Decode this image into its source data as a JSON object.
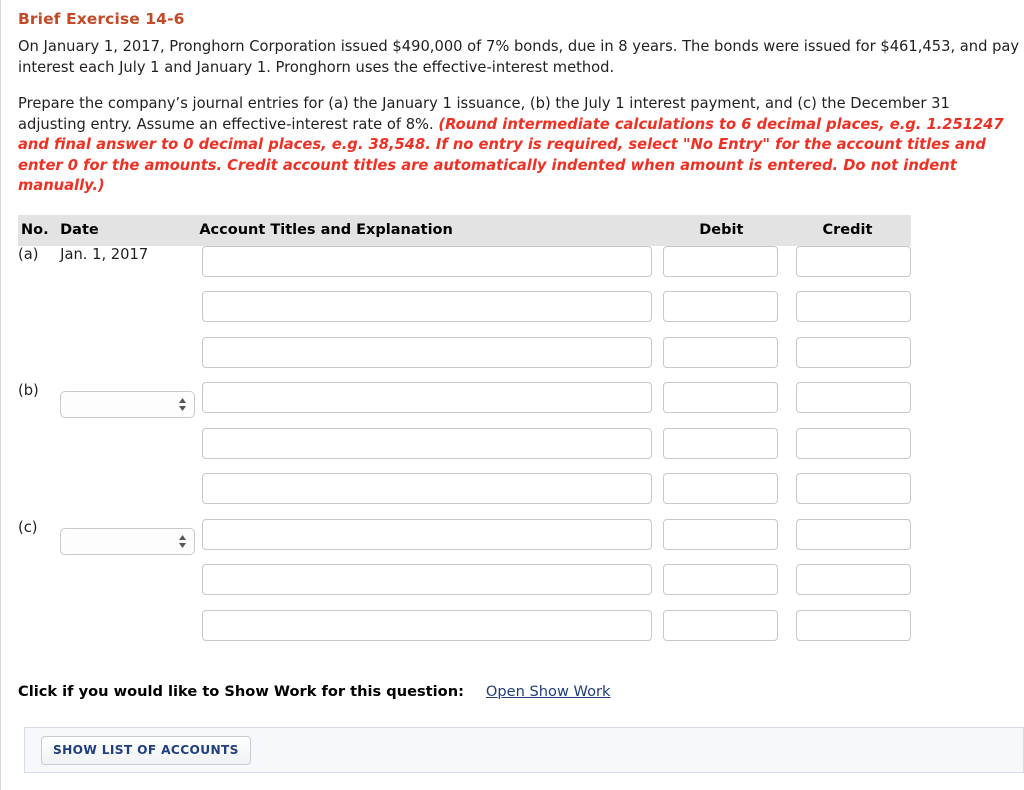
{
  "exercise": {
    "title": "Brief Exercise 14-6",
    "paragraph1": "On January 1, 2017, Pronghorn Corporation issued $490,000 of 7% bonds, due in 8 years. The bonds were issued for $461,453, and pay interest each July 1 and January 1. Pronghorn uses the effective-interest method.",
    "paragraph2_plain": "Prepare the company’s journal entries for (a) the January 1 issuance, (b) the July 1 interest payment, and (c) the December 31 adjusting entry. Assume an effective-interest rate of 8%. ",
    "paragraph2_emphasis": "(Round intermediate calculations to 6 decimal places, e.g. 1.251247 and final answer to 0 decimal places, e.g. 38,548. If no entry is required, select \"No Entry\" for the account titles and enter 0 for the amounts. Credit account titles are automatically indented when amount is entered. Do not indent manually.)"
  },
  "table": {
    "headers": {
      "no": "No.",
      "date": "Date",
      "account": "Account Titles and Explanation",
      "debit": "Debit",
      "credit": "Credit"
    },
    "rows": [
      {
        "no": "(a)",
        "date_type": "text",
        "date": "Jan. 1, 2017",
        "account": "",
        "debit": "",
        "credit": ""
      },
      {
        "no": "",
        "date_type": "none",
        "date": "",
        "account": "",
        "debit": "",
        "credit": ""
      },
      {
        "no": "",
        "date_type": "none",
        "date": "",
        "account": "",
        "debit": "",
        "credit": ""
      },
      {
        "no": "(b)",
        "date_type": "select",
        "date": "",
        "account": "",
        "debit": "",
        "credit": ""
      },
      {
        "no": "",
        "date_type": "none",
        "date": "",
        "account": "",
        "debit": "",
        "credit": ""
      },
      {
        "no": "",
        "date_type": "none",
        "date": "",
        "account": "",
        "debit": "",
        "credit": ""
      },
      {
        "no": "(c)",
        "date_type": "select",
        "date": "",
        "account": "",
        "debit": "",
        "credit": ""
      },
      {
        "no": "",
        "date_type": "none",
        "date": "",
        "account": "",
        "debit": "",
        "credit": ""
      },
      {
        "no": "",
        "date_type": "none",
        "date": "",
        "account": "",
        "debit": "",
        "credit": ""
      }
    ],
    "date_select_selected": "",
    "input_placeholder": ""
  },
  "show_work": {
    "label": "Click if you would like to Show Work for this question:",
    "link": "Open Show Work"
  },
  "footer": {
    "show_list_button": "SHOW LIST OF ACCOUNTS"
  },
  "colors": {
    "title": "#c24a27",
    "emphasis": "#ee3124",
    "link": "#1f3d7a",
    "header_bg": "#e3e3e3",
    "panel_bg": "#f6f8fb",
    "button_text": "#1f3f7e"
  },
  "icons": {
    "stepper": "stepper-arrows-icon"
  }
}
